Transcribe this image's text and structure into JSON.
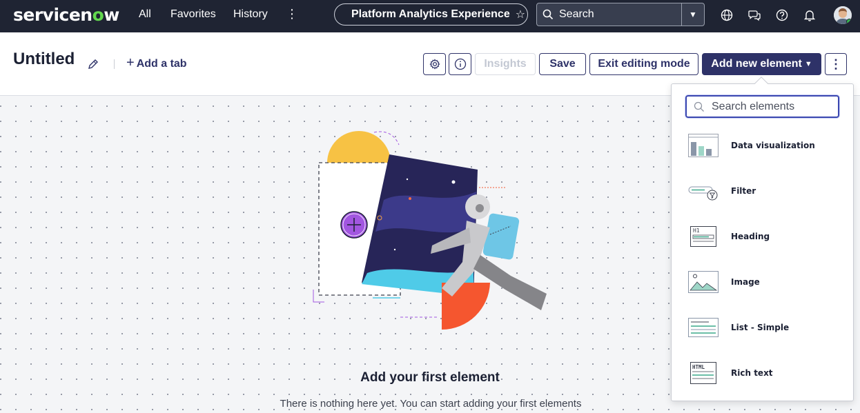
{
  "nav": {
    "logo_pre": "servicen",
    "logo_o": "o",
    "logo_post": "w",
    "links": [
      "All",
      "Favorites",
      "History"
    ],
    "app_title": "Platform Analytics Experience",
    "search_label": "Search"
  },
  "header": {
    "title": "Untitled",
    "add_tab": "Add a tab",
    "insights": "Insights",
    "save": "Save",
    "exit": "Exit editing mode",
    "add_element": "Add new element"
  },
  "canvas": {
    "empty_title": "Add your first element",
    "empty_desc": "There is nothing here yet. You can start adding your first elements"
  },
  "panel": {
    "search_placeholder": "Search elements",
    "items": [
      {
        "label": "Data visualization",
        "icon": "data-visualization-icon"
      },
      {
        "label": "Filter",
        "icon": "filter-icon"
      },
      {
        "label": "Heading",
        "icon": "heading-icon"
      },
      {
        "label": "Image",
        "icon": "image-icon"
      },
      {
        "label": "List - Simple",
        "icon": "list-icon"
      },
      {
        "label": "Rich text",
        "icon": "rich-text-icon"
      }
    ],
    "thumb_text": {
      "heading": "H1",
      "html": "HTML"
    }
  },
  "colors": {
    "nav_bg": "#1f2433",
    "primary": "#2e3268",
    "accent_green": "#62d84e",
    "focus": "#3b47b0"
  }
}
